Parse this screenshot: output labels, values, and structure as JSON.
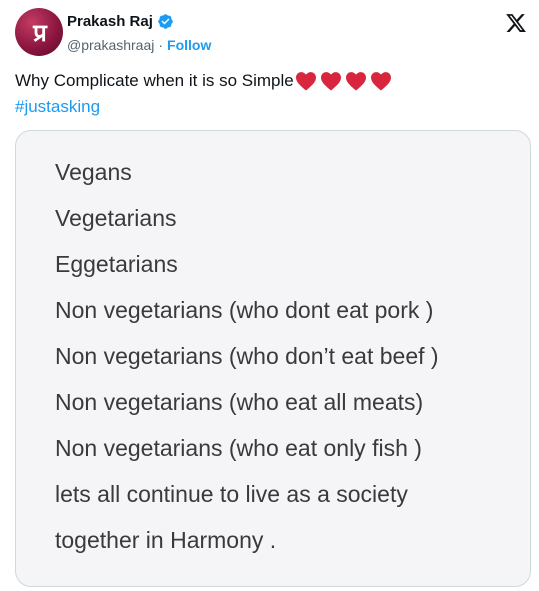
{
  "author": {
    "avatar_letters": "प्र",
    "name": "Prakash Raj",
    "handle": "@prakashraaj",
    "separator": "·",
    "follow_label": "Follow"
  },
  "tweet": {
    "text": "Why Complicate when it is so Simple",
    "heart_count": 4,
    "hashtag": "#justasking"
  },
  "image_card": {
    "lines": [
      "Vegans",
      "Vegetarians",
      "Eggetarians",
      "Non vegetarians (who dont eat pork )",
      "Non vegetarians (who don’t eat beef )",
      "Non vegetarians (who eat all meats)",
      "Non vegetarians (who eat only fish )",
      "lets all continue to live as a society",
      "together in Harmony ."
    ]
  },
  "colors": {
    "link": "#1d9bf0",
    "verified": "#1d9bf0",
    "heart": "#d7263d",
    "card_bg": "#f5f5f7"
  }
}
